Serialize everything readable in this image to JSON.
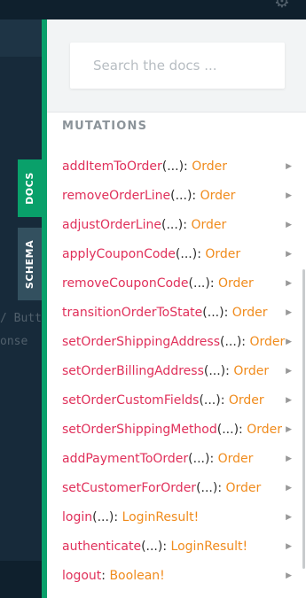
{
  "tabs": {
    "docs": "DOCS",
    "schema": "SCHEMA"
  },
  "search": {
    "placeholder": "Search the docs ..."
  },
  "section_title": "MUTATIONS",
  "editor": {
    "line1": "/ Butt",
    "line2": "onse"
  },
  "mutations": [
    {
      "name": "addItemToOrder",
      "args": "(...)",
      "type": "Order"
    },
    {
      "name": "removeOrderLine",
      "args": "(...)",
      "type": "Order"
    },
    {
      "name": "adjustOrderLine",
      "args": "(...)",
      "type": "Order"
    },
    {
      "name": "applyCouponCode",
      "args": "(...)",
      "type": "Order"
    },
    {
      "name": "removeCouponCode",
      "args": "(...)",
      "type": "Order"
    },
    {
      "name": "transitionOrderToState",
      "args": "(...)",
      "type": "Order"
    },
    {
      "name": "setOrderShippingAddress",
      "args": "(...)",
      "type": "Order"
    },
    {
      "name": "setOrderBillingAddress",
      "args": "(...)",
      "type": "Order"
    },
    {
      "name": "setOrderCustomFields",
      "args": "(...)",
      "type": "Order"
    },
    {
      "name": "setOrderShippingMethod",
      "args": "(...)",
      "type": "Order"
    },
    {
      "name": "addPaymentToOrder",
      "args": "(...)",
      "type": "Order"
    },
    {
      "name": "setCustomerForOrder",
      "args": "(...)",
      "type": "Order"
    },
    {
      "name": "login",
      "args": "(...)",
      "type": "LoginResult!"
    },
    {
      "name": "authenticate",
      "args": "(...)",
      "type": "LoginResult!"
    },
    {
      "name": "logout",
      "args": "",
      "type": "Boolean!"
    }
  ],
  "icons": {
    "settings": "gear-icon",
    "expand": "chevron-right-icon"
  }
}
